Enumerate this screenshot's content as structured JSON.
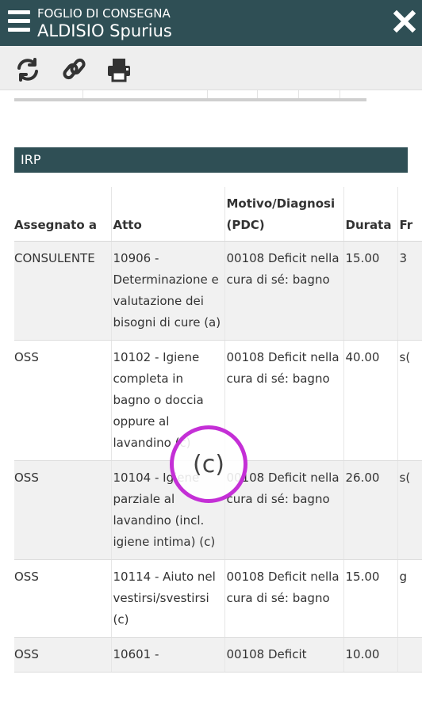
{
  "header": {
    "subtitle": "FOGLIO DI CONSEGNA",
    "title": "ALDISIO Spurius"
  },
  "toolbar": {
    "icons": [
      "refresh-icon",
      "link-icon",
      "print-icon"
    ]
  },
  "section": {
    "title": "IRP"
  },
  "table": {
    "columns": [
      "Assegnato a",
      "Atto",
      "Motivo/Diagnosi (PDC)",
      "Durata",
      "Fr"
    ],
    "rows": [
      {
        "assegnato": "CONSULENTE",
        "atto": "10906 - Determinazione e valutazione dei bisogni di cure (a)",
        "motivo": "00108 Deficit nella cura di sé: bagno",
        "durata": "15.00",
        "fr": "3"
      },
      {
        "assegnato": "OSS",
        "atto": "10102 - Igiene completa in bagno o doccia oppure al lavandino (c)",
        "motivo": "00108 Deficit nella cura di sé: bagno",
        "durata": "40.00",
        "fr": "s("
      },
      {
        "assegnato": "OSS",
        "atto": "10104 - Igiene parziale al lavandino (incl. igiene intima) (c)",
        "motivo": "00108 Deficit nella cura di sé: bagno",
        "durata": "26.00",
        "fr": "s("
      },
      {
        "assegnato": "OSS",
        "atto": "10114 - Aiuto nel vestirsi/svestirsi (c)",
        "motivo": "00108 Deficit nella cura di sé: bagno",
        "durata": "15.00",
        "fr": "g"
      },
      {
        "assegnato": "OSS",
        "atto": "10601 -",
        "motivo": "00108 Deficit",
        "durata": "10.00",
        "fr": ""
      }
    ]
  },
  "annotation": {
    "label": "(c)"
  },
  "colors": {
    "header_bg": "#2f4f55",
    "annotation_ring": "#c42fd6",
    "row_alt": "#f1f1f1"
  }
}
